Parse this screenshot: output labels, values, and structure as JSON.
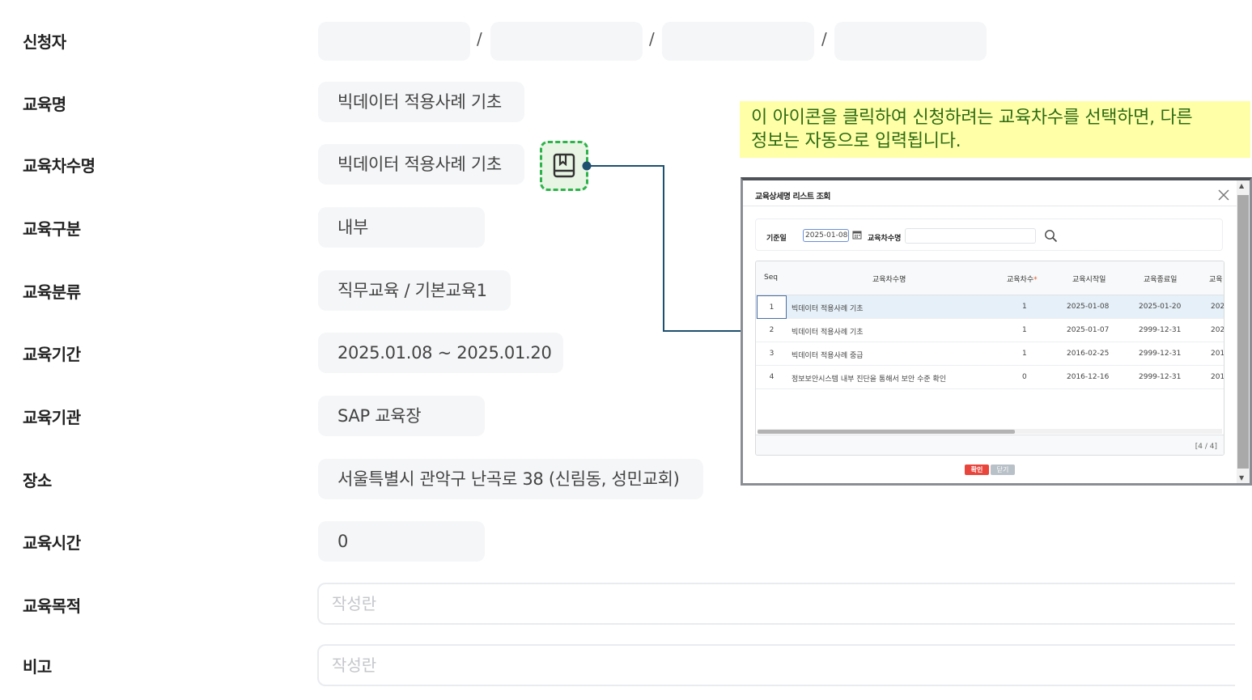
{
  "form": {
    "labels": {
      "applicant": "신청자",
      "course_name": "교육명",
      "session_name": "교육차수명",
      "category": "교육구분",
      "classification": "교육분류",
      "period": "교육기간",
      "institution": "교육기관",
      "location": "장소",
      "hours": "교육시간",
      "purpose": "교육목적",
      "remarks": "비고"
    },
    "applicant_separator": "/",
    "values": {
      "course_name": "빅데이터 적용사례 기초",
      "session_name": "빅데이터 적용사례 기초",
      "category": "내부",
      "classification": "직무교육 / 기본교육1",
      "period": "2025.01.08 ~ 2025.01.20",
      "institution": "SAP 교육장",
      "location": "서울특별시 관악구 난곡로 38 (신림동, 성민교회)",
      "hours": "0"
    },
    "placeholders": {
      "purpose": "작성란",
      "remarks": "작성란"
    }
  },
  "callout": {
    "line1": "이 아이콘을 클릭하여 신청하려는 교육차수를 선택하면, 다른",
    "line2": "정보는 자동으로 입력됩니다.",
    "background": "#ffffa8",
    "text_color": "#2d6b12"
  },
  "modal": {
    "title": "교육상세명 리스트 조회",
    "search": {
      "base_date_label": "기준일",
      "base_date_value": "2025-01-08",
      "session_label": "교육차수명"
    },
    "columns": {
      "seq": "Seq",
      "name": "교육차수명",
      "count": "교육차수",
      "count_required_mark": "*",
      "start": "교육시작일",
      "end": "교육종료일",
      "extra": "교육"
    },
    "rows": [
      {
        "seq": "1",
        "name": "빅데이터 적용사례 기초",
        "count": "1",
        "start": "2025-01-08",
        "end": "2025-01-20",
        "extra": "202"
      },
      {
        "seq": "2",
        "name": "빅데이터 적용사례 기초",
        "count": "1",
        "start": "2025-01-07",
        "end": "2999-12-31",
        "extra": "202"
      },
      {
        "seq": "3",
        "name": "빅데이터 적용사례 중급",
        "count": "1",
        "start": "2016-02-25",
        "end": "2999-12-31",
        "extra": "201"
      },
      {
        "seq": "4",
        "name": "정보보안시스템 내부 진단을 통해서 보안 수준 확인",
        "count": "0",
        "start": "2016-12-16",
        "end": "2999-12-31",
        "extra": "201"
      }
    ],
    "pager": "[4 / 4]",
    "confirm_label": "확인",
    "close_label": "닫기"
  },
  "colors": {
    "accent_green": "#2db34a",
    "connector": "#1d4f6e",
    "confirm_red": "#e8453c",
    "selected_row": "#e6f0f8"
  },
  "icons": {
    "session_picker": "book-bookmark-icon",
    "modal_close": "close-icon",
    "calendar": "calendar-icon",
    "search": "search-icon"
  }
}
